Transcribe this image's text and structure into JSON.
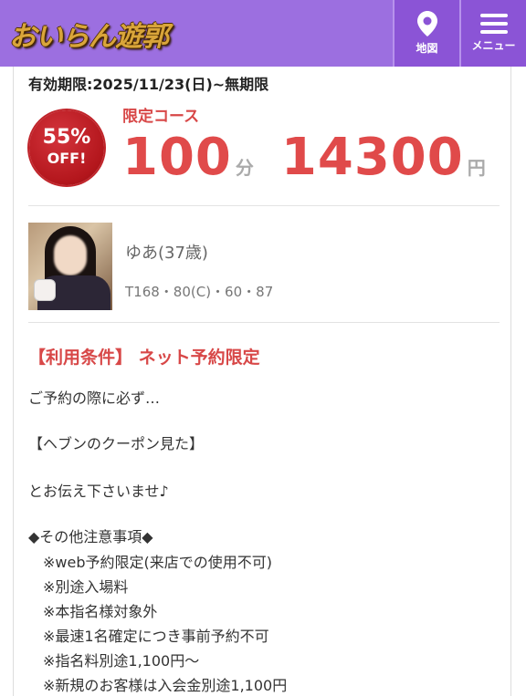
{
  "header": {
    "logo_text": "おいらん遊郭",
    "map_label": "地図",
    "menu_label": "メニュー"
  },
  "coupon": {
    "validity": "有効期限:2025/11/23(日)~無期限",
    "badge_percent": "55%",
    "badge_off": "OFF!",
    "course_name": "限定コース",
    "duration": "100",
    "duration_unit": "分",
    "price": "14300",
    "price_unit": "円"
  },
  "girl": {
    "name": "ゆあ(37歳)",
    "measurements": "T168・80(C)・60・87"
  },
  "conditions": {
    "title": "【利用条件】 ネット予約限定",
    "lines": [
      "ご予約の際に必ず…",
      "【ヘブンのクーポン見た】",
      "とお伝え下さいませ♪",
      "◆その他注意事項◆",
      "　※web予約限定(来店での使用不可)",
      "　※別途入場料",
      "　※本指名様対象外",
      "　※最速1名確定につき事前予約不可",
      "　※指名料別途1,100円〜",
      "　※新規のお客様は入会金別途1,100円"
    ]
  },
  "colors": {
    "header_bg": "#9c6fe0",
    "accent_red": "#d84848",
    "badge_red": "#b3161c"
  }
}
